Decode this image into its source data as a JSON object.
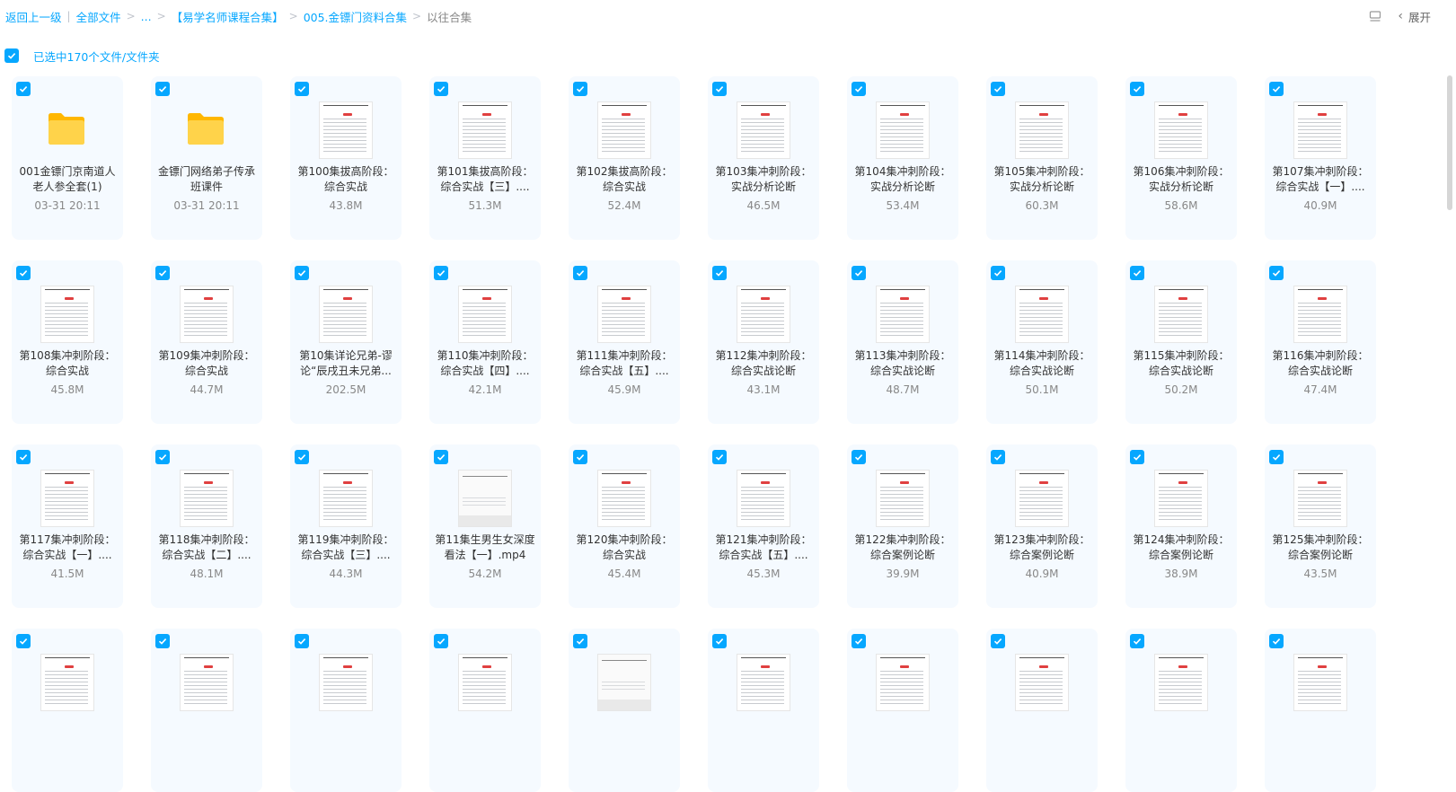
{
  "breadcrumb": {
    "back": "返回上一级",
    "items": [
      "全部文件",
      "...",
      "【易学名师课程合集】",
      "005.金镖门资料合集"
    ],
    "current": "以往合集"
  },
  "toolbar": {
    "expand_label": "展开"
  },
  "selection": {
    "label": "已选中170个文件/文件夹"
  },
  "files": [
    {
      "type": "folder",
      "name": "001金镖门京南道人老人参全套(1)",
      "meta": "03-31 20:11"
    },
    {
      "type": "folder",
      "name": "金镖门网络弟子传承班课件",
      "meta": "03-31 20:11"
    },
    {
      "type": "doc",
      "name": "第100集拔高阶段：综合实战",
      "meta": "43.8M"
    },
    {
      "type": "doc",
      "name": "第101集拔高阶段：综合实战【三】....",
      "meta": "51.3M"
    },
    {
      "type": "doc",
      "name": "第102集拔高阶段：综合实战",
      "meta": "52.4M"
    },
    {
      "type": "doc",
      "name": "第103集冲刺阶段：实战分析论断",
      "meta": "46.5M"
    },
    {
      "type": "doc",
      "name": "第104集冲刺阶段：实战分析论断",
      "meta": "53.4M"
    },
    {
      "type": "doc",
      "name": "第105集冲刺阶段：实战分析论断",
      "meta": "60.3M"
    },
    {
      "type": "doc",
      "name": "第106集冲刺阶段：实战分析论断",
      "meta": "58.6M"
    },
    {
      "type": "doc",
      "name": "第107集冲刺阶段：综合实战【一】....",
      "meta": "40.9M"
    },
    {
      "type": "doc",
      "name": "第108集冲刺阶段：综合实战",
      "meta": "45.8M"
    },
    {
      "type": "doc",
      "name": "第109集冲刺阶段：综合实战",
      "meta": "44.7M"
    },
    {
      "type": "doc",
      "name": "第10集详论兄弟-谬论“辰戌丑未兄弟...",
      "meta": "202.5M"
    },
    {
      "type": "doc",
      "name": "第110集冲刺阶段：综合实战【四】....",
      "meta": "42.1M"
    },
    {
      "type": "doc",
      "name": "第111集冲刺阶段：综合实战【五】....",
      "meta": "45.9M"
    },
    {
      "type": "doc",
      "name": "第112集冲刺阶段：综合实战论断",
      "meta": "43.1M"
    },
    {
      "type": "doc",
      "name": "第113集冲刺阶段：综合实战论断",
      "meta": "48.7M"
    },
    {
      "type": "doc",
      "name": "第114集冲刺阶段：综合实战论断",
      "meta": "50.1M"
    },
    {
      "type": "doc",
      "name": "第115集冲刺阶段：综合实战论断",
      "meta": "50.2M"
    },
    {
      "type": "doc",
      "name": "第116集冲刺阶段：综合实战论断",
      "meta": "47.4M"
    },
    {
      "type": "doc",
      "name": "第117集冲刺阶段：综合实战【一】....",
      "meta": "41.5M"
    },
    {
      "type": "doc",
      "name": "第118集冲刺阶段：综合实战【二】....",
      "meta": "48.1M"
    },
    {
      "type": "doc",
      "name": "第119集冲刺阶段：综合实战【三】....",
      "meta": "44.3M"
    },
    {
      "type": "video",
      "name": "第11集生男生女深度看法【一】.mp4",
      "meta": "54.2M"
    },
    {
      "type": "doc",
      "name": "第120集冲刺阶段：综合实战",
      "meta": "45.4M"
    },
    {
      "type": "doc",
      "name": "第121集冲刺阶段：综合实战【五】....",
      "meta": "45.3M"
    },
    {
      "type": "doc",
      "name": "第122集冲刺阶段：综合案例论断",
      "meta": "39.9M"
    },
    {
      "type": "doc",
      "name": "第123集冲刺阶段：综合案例论断",
      "meta": "40.9M"
    },
    {
      "type": "doc",
      "name": "第124集冲刺阶段：综合案例论断",
      "meta": "38.9M"
    },
    {
      "type": "doc",
      "name": "第125集冲刺阶段：综合案例论断",
      "meta": "43.5M"
    },
    {
      "type": "doc",
      "name": "",
      "meta": ""
    },
    {
      "type": "doc",
      "name": "",
      "meta": ""
    },
    {
      "type": "doc",
      "name": "",
      "meta": ""
    },
    {
      "type": "doc",
      "name": "",
      "meta": ""
    },
    {
      "type": "video",
      "name": "",
      "meta": ""
    },
    {
      "type": "doc",
      "name": "",
      "meta": ""
    },
    {
      "type": "doc",
      "name": "",
      "meta": ""
    },
    {
      "type": "doc",
      "name": "",
      "meta": ""
    },
    {
      "type": "doc",
      "name": "",
      "meta": ""
    },
    {
      "type": "doc",
      "name": "",
      "meta": ""
    }
  ],
  "colors": {
    "accent": "#06a7ff",
    "card_bg": "#f5faff",
    "folder": "#ffc83d"
  }
}
